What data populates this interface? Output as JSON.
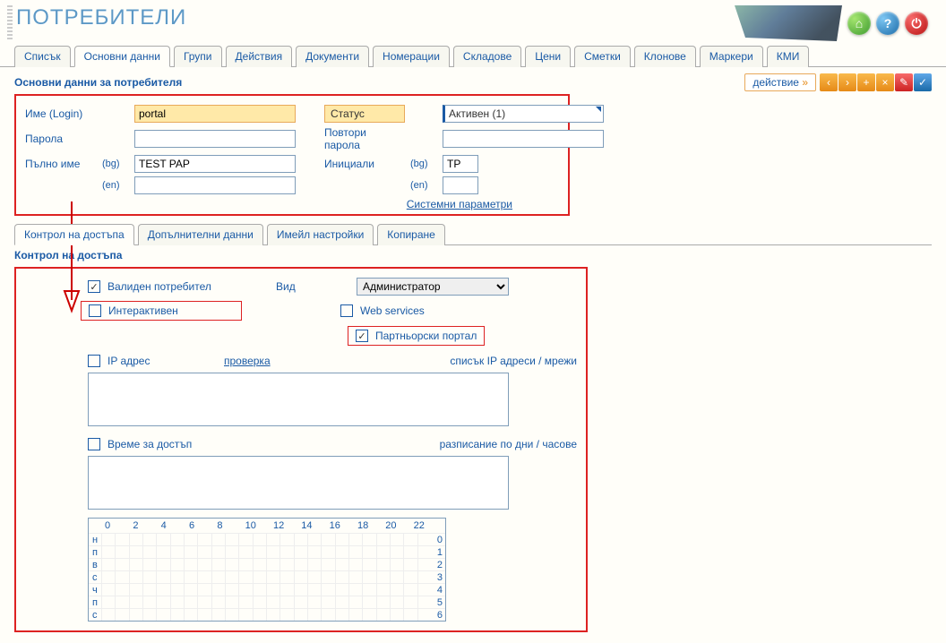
{
  "page": {
    "title": "ПОТРЕБИТЕЛИ"
  },
  "header_icons": {
    "home_glyph": "⌂",
    "help_glyph": "?",
    "power_glyph": "⏻"
  },
  "tabs": {
    "items": [
      "Списък",
      "Основни данни",
      "Групи",
      "Действия",
      "Документи",
      "Номерации",
      "Складове",
      "Цени",
      "Сметки",
      "Клонове",
      "Маркери",
      "КМИ"
    ],
    "active_index": 1
  },
  "section": {
    "title": "Основни данни за потребителя",
    "action_label": "действие",
    "action_arrow": "»"
  },
  "toolbar": {
    "prev": "‹",
    "next": "›",
    "add": "+",
    "close": "×",
    "edit": "✎",
    "ok": "✓"
  },
  "form": {
    "login_label": "Име (Login)",
    "login_value": "portal",
    "status_label": "Статус",
    "status_value": "Активен (1)",
    "password_label": "Парола",
    "password_value": "",
    "repeat_password_label": "Повтори парола",
    "repeat_password_value": "",
    "fullname_label": "Пълно име",
    "lang_bg": "(bg)",
    "lang_en": "(en)",
    "fullname_bg_value": "TEST PAP",
    "fullname_en_value": "",
    "initials_label": "Инициали",
    "initials_bg_value": "TP",
    "initials_en_value": "",
    "system_params_link": "Системни параметри"
  },
  "sub_tabs": {
    "items": [
      "Контрол на достъпа",
      "Допълнителни данни",
      "Имейл настройки",
      "Копиране"
    ],
    "active_index": 0
  },
  "access": {
    "section_title": "Контрол на достъпа",
    "valid_user_label": "Валиден потребител",
    "valid_user_checked": true,
    "kind_label": "Вид",
    "kind_value": "Администратор",
    "interactive_label": "Интерактивен",
    "interactive_checked": false,
    "web_services_label": "Web services",
    "web_services_checked": false,
    "partner_portal_label": "Партньорски портал",
    "partner_portal_checked": true,
    "ip_label": "IP адрес",
    "ip_checked": false,
    "check_link": "проверка",
    "ip_list_link": "списък IP адреси / мрежи",
    "time_label": "Време за достъп",
    "time_checked": false,
    "schedule_link": "разписание по дни / часове",
    "hours": [
      "0",
      "2",
      "4",
      "6",
      "8",
      "10",
      "12",
      "14",
      "16",
      "18",
      "20",
      "22"
    ],
    "days": [
      "н",
      "п",
      "в",
      "с",
      "ч",
      "п",
      "с"
    ],
    "day_nums": [
      "0",
      "1",
      "2",
      "3",
      "4",
      "5",
      "6"
    ]
  }
}
